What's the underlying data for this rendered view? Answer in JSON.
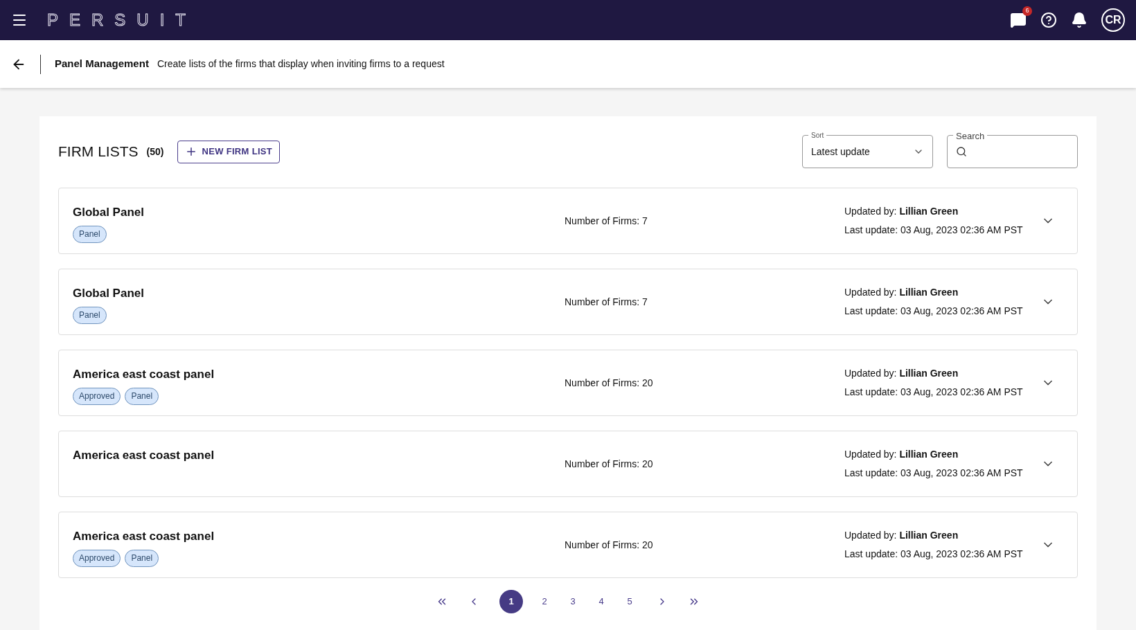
{
  "topbar": {
    "logo": "PERSUIT",
    "messages_badge": "6",
    "avatar": "CR"
  },
  "header": {
    "title": "Panel Management",
    "subtitle": "Create lists of the firms that display when inviting firms to a request"
  },
  "firm_lists": {
    "title": "FIRM LISTS",
    "count": "(50)",
    "new_button": "NEW FIRM LIST",
    "sort": {
      "label": "Sort",
      "value": "Latest update"
    },
    "search": {
      "label": "Search"
    },
    "rows": [
      {
        "name": "Global Panel",
        "tags": [
          "Panel"
        ],
        "firms": "Number of Firms: 7",
        "updated_by": "Updated by: **Lillian Green**",
        "last_update": "Last update: 03 Aug, 2023 02:36 AM PST"
      },
      {
        "name": "Global Panel",
        "tags": [
          "Panel"
        ],
        "firms": "Number of Firms: 7",
        "updated_by": "Updated by: **Lillian Green**",
        "last_update": "Last update: 03 Aug, 2023 02:36 AM PST"
      },
      {
        "name": "America east coast panel",
        "tags": [
          "Approved",
          "Panel"
        ],
        "firms": "Number of Firms: 20",
        "updated_by": "Updated by: **Lillian Green**",
        "last_update": "Last update: 03 Aug, 2023 02:36 AM PST"
      },
      {
        "name": "America east coast panel",
        "tags": [],
        "firms": "Number of Firms: 20",
        "updated_by": "Updated by: **Lillian Green**",
        "last_update": "Last update: 03 Aug, 2023 02:36 AM PST"
      },
      {
        "name": "America east coast panel",
        "tags": [
          "Approved",
          "Panel"
        ],
        "firms": "Number of Firms: 20",
        "updated_by": "Updated by: **Lillian Green**",
        "last_update": "Last update: 03 Aug, 2023 02:36 AM PST"
      }
    ]
  },
  "pagination": {
    "pages": [
      {
        "label": "1",
        "selected": true
      },
      {
        "label": "2",
        "selected": false
      },
      {
        "label": "3",
        "selected": false
      },
      {
        "label": "4",
        "selected": false
      },
      {
        "label": "5",
        "selected": false
      }
    ]
  }
}
